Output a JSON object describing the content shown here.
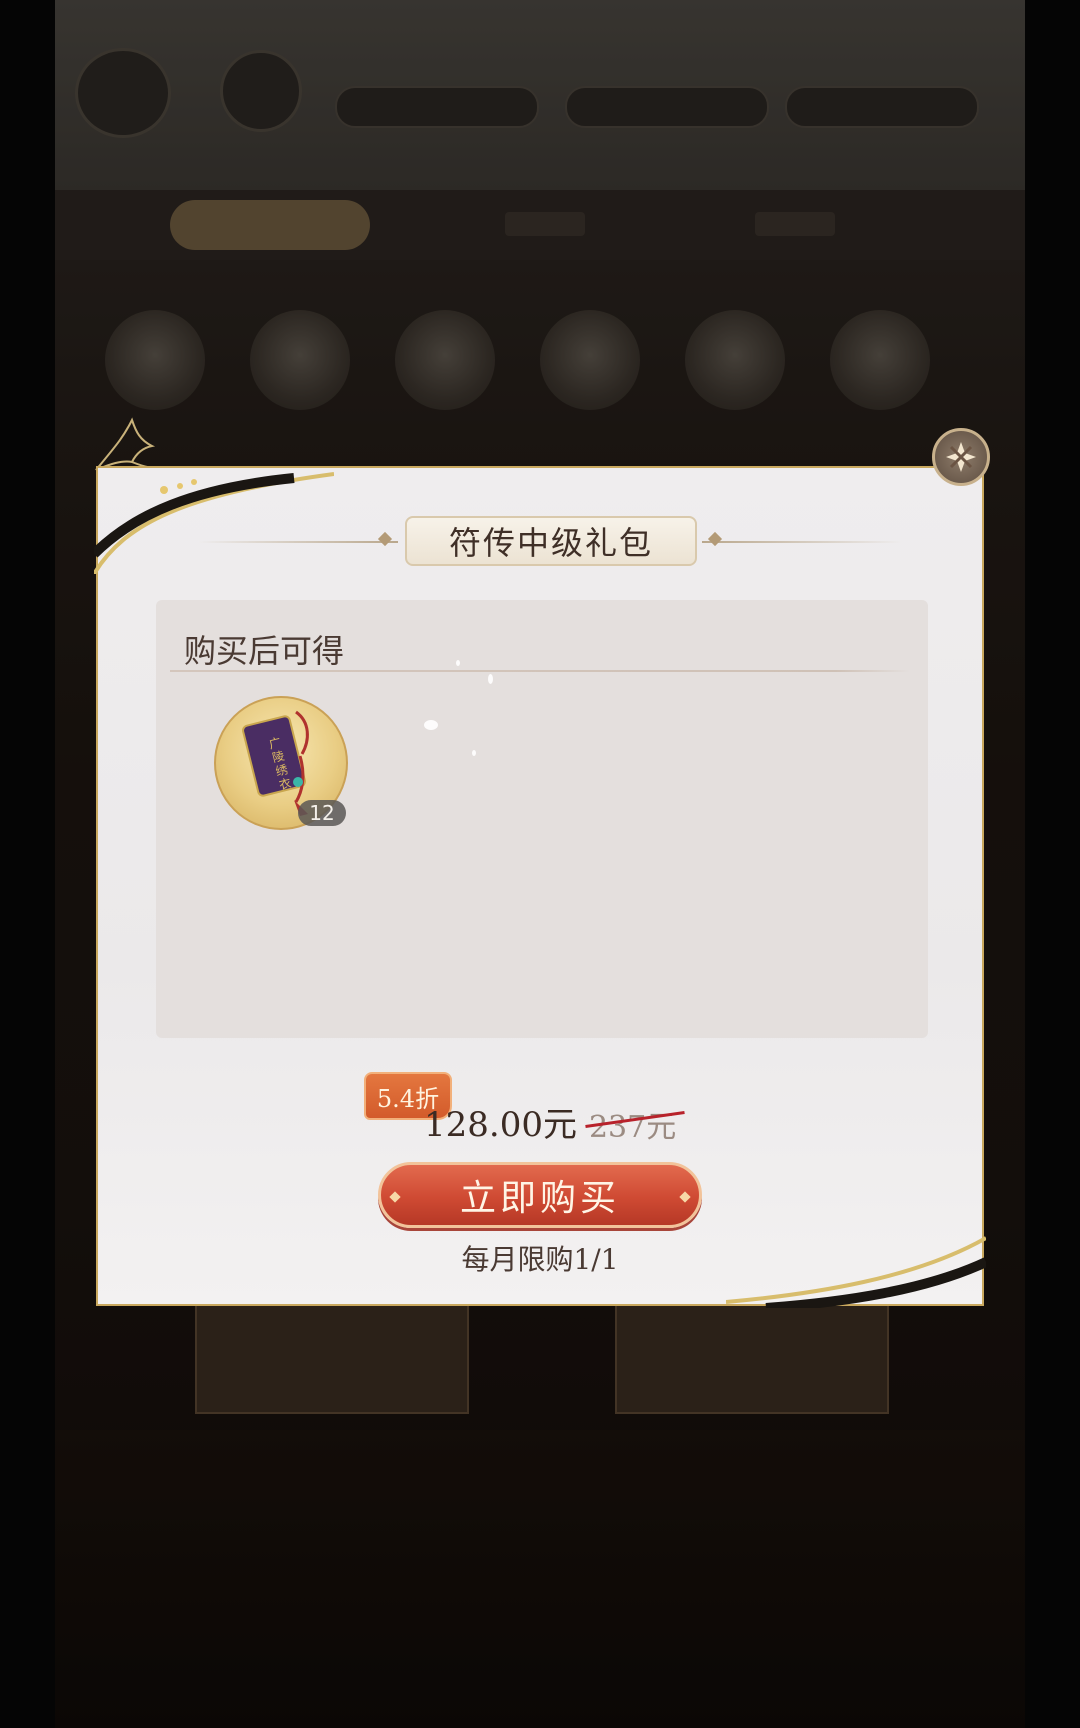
{
  "dialog": {
    "title": "符传中级礼包",
    "reward_heading": "购买后可得",
    "rewards": [
      {
        "icon": "talisman-scroll-icon",
        "count": "12"
      }
    ],
    "discount": "5.4折",
    "price_current": "128.00元",
    "price_original": "237元",
    "buy_label": "立即购买",
    "purchase_limit": "每月限购1/1"
  },
  "colors": {
    "accent_gold": "#c9a85e",
    "buy_button": "#cf4a33",
    "discount_badge": "#d35b2b",
    "strike_line": "#b8222b"
  }
}
